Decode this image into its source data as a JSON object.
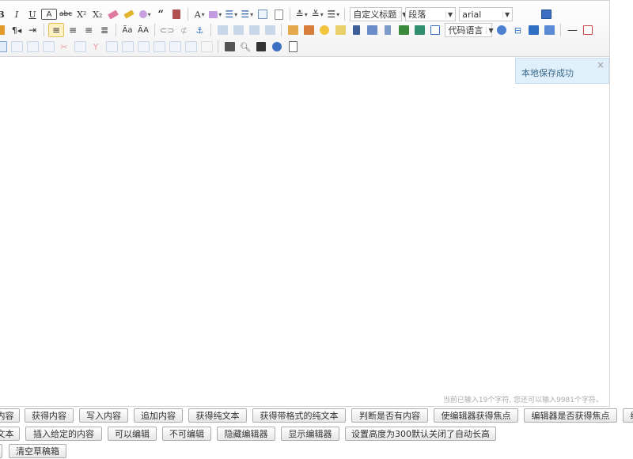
{
  "toolbar": {
    "heading_select": "自定义标题",
    "paragraph_select": "段落",
    "font_select": "arial",
    "code_lang_select": "代码语言",
    "colors": {
      "accent_active_bg": "#fdf0c3",
      "toast_bg": "#e0f0fa"
    }
  },
  "toast": {
    "message": "本地保存成功",
    "close": "×"
  },
  "status": {
    "text": "当前已输入19个字符, 您还可以输入9981个字符。"
  },
  "buttons": {
    "row1": [
      "内容",
      "获得内容",
      "写入内容",
      "追加内容",
      "获得纯文本",
      "获得带格式的纯文本",
      "判断是否有内容",
      "使编辑器获得焦点",
      "编辑器是否获得焦点",
      "编"
    ],
    "row2": [
      "文本",
      "插入给定的内容",
      "可以编辑",
      "不可编辑",
      "隐藏编辑器",
      "显示编辑器",
      "设置高度为300默认关闭了自动长高"
    ],
    "row3": [
      "",
      "清空草稿箱"
    ]
  }
}
